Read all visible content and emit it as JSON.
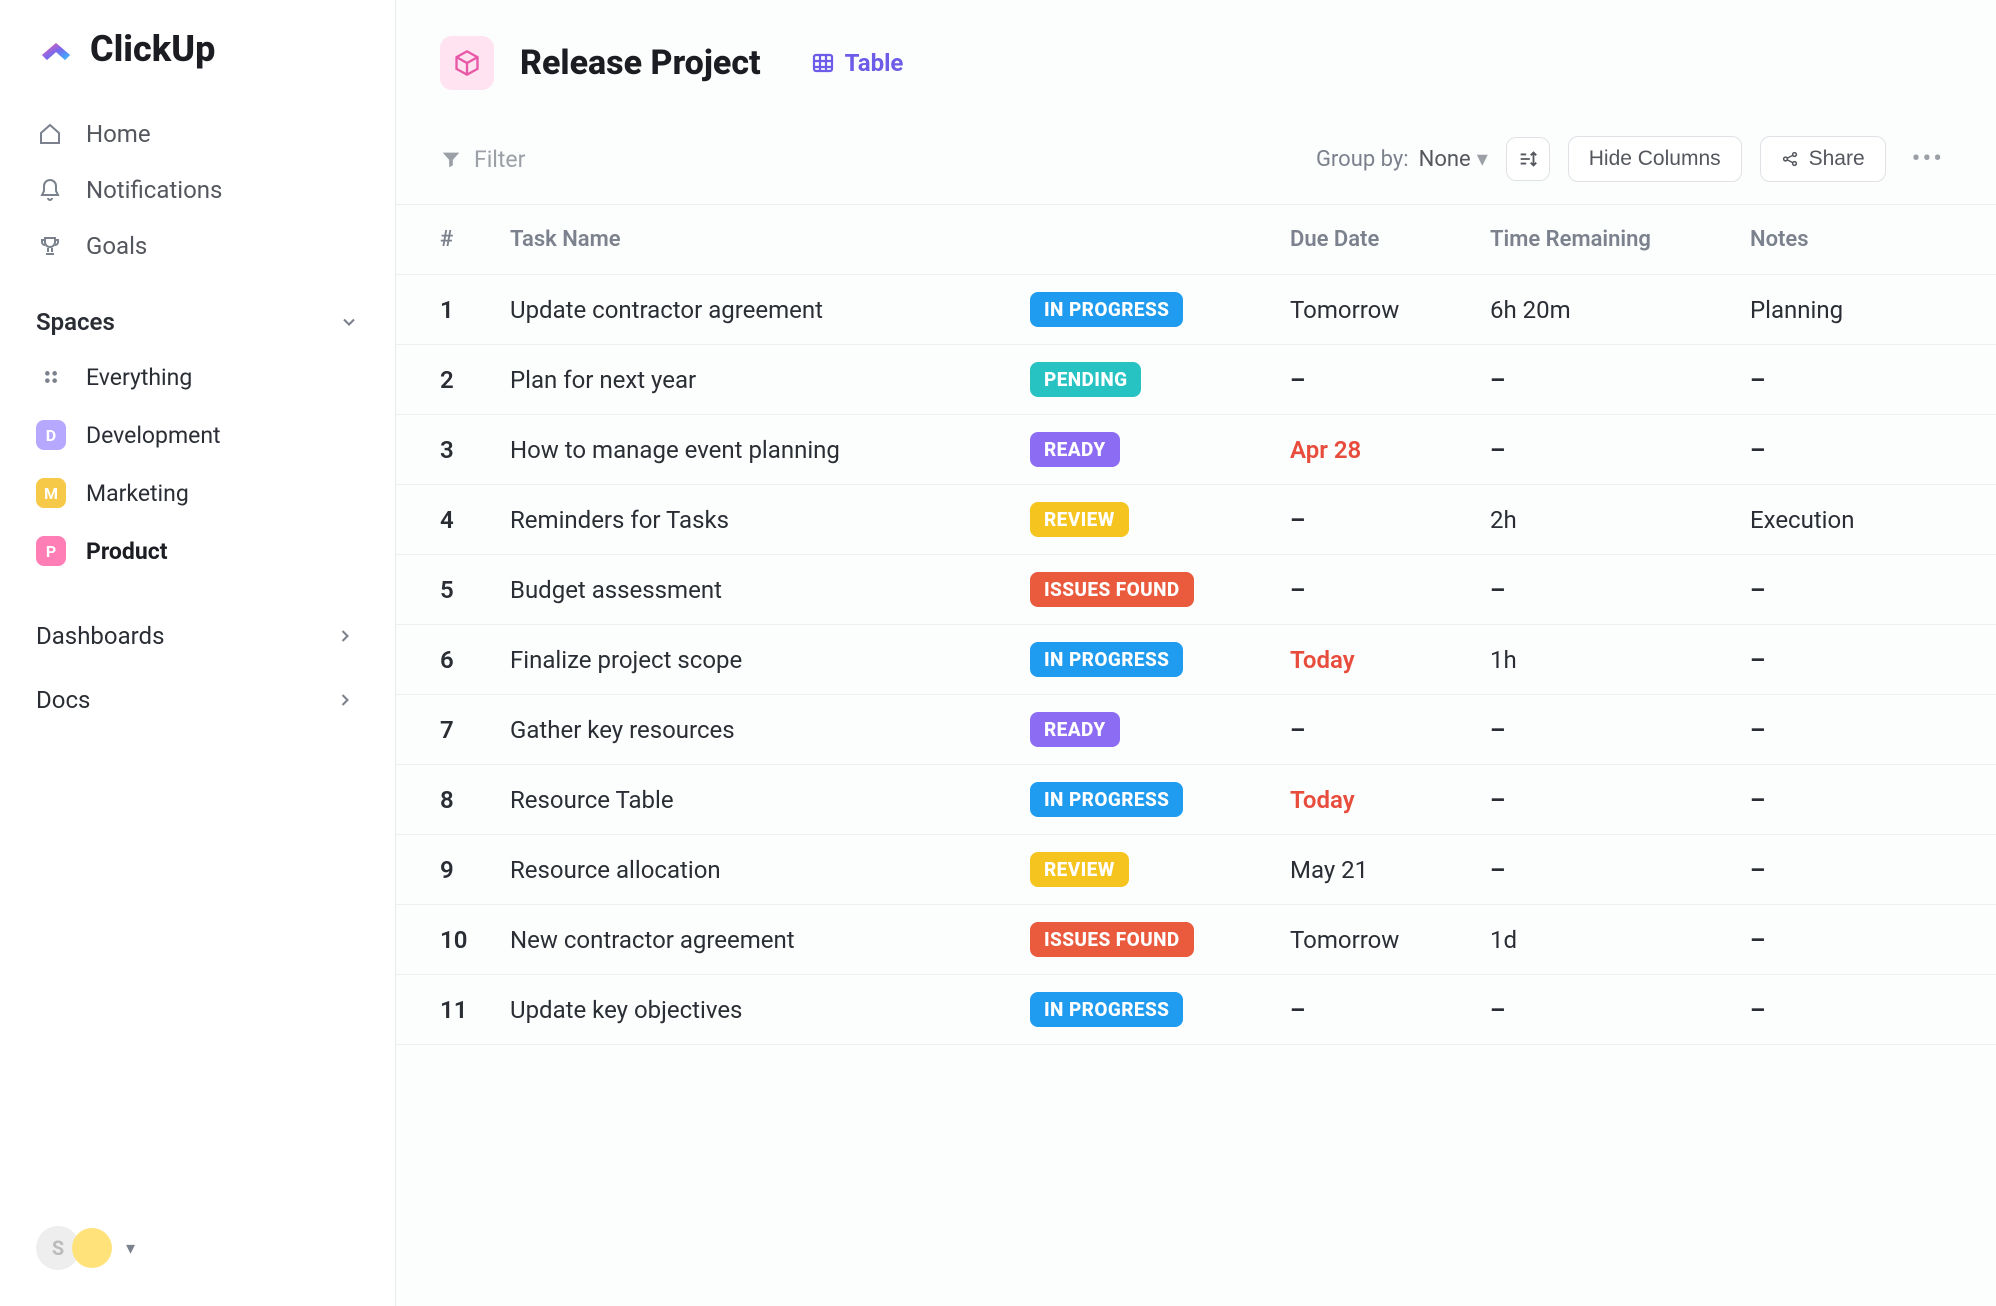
{
  "brand": {
    "name": "ClickUp"
  },
  "sidebar": {
    "nav": [
      {
        "label": "Home"
      },
      {
        "label": "Notifications"
      },
      {
        "label": "Goals"
      }
    ],
    "spaces": {
      "title": "Spaces",
      "everything_label": "Everything",
      "items": [
        {
          "letter": "D",
          "label": "Development",
          "color": "#b7a8ff"
        },
        {
          "letter": "M",
          "label": "Marketing",
          "color": "#f7c948"
        },
        {
          "letter": "P",
          "label": "Product",
          "color": "#ff7eb6",
          "active": true
        }
      ]
    },
    "sections": [
      {
        "label": "Dashboards"
      },
      {
        "label": "Docs"
      }
    ],
    "avatar_letter": "S"
  },
  "header": {
    "project_title": "Release Project",
    "view_label": "Table"
  },
  "toolbar": {
    "filter_label": "Filter",
    "groupby_label": "Group by:",
    "groupby_value": "None",
    "hide_columns_label": "Hide Columns",
    "share_label": "Share"
  },
  "columns": {
    "num": "#",
    "task": "Task Name",
    "status": "",
    "due": "Due Date",
    "time": "Time Remaining",
    "notes": "Notes"
  },
  "status_styles": {
    "IN PROGRESS": "st-inprogress",
    "PENDING": "st-pending",
    "READY": "st-ready",
    "REVIEW": "st-review",
    "ISSUES FOUND": "st-issues"
  },
  "urgent_due_values": [
    "Today",
    "Apr 28"
  ],
  "tasks": [
    {
      "n": "1",
      "name": "Update contractor agreement",
      "status": "IN PROGRESS",
      "due": "Tomorrow",
      "time": "6h 20m",
      "notes": "Planning"
    },
    {
      "n": "2",
      "name": "Plan for next year",
      "status": "PENDING",
      "due": "–",
      "time": "–",
      "notes": "–"
    },
    {
      "n": "3",
      "name": "How to manage event planning",
      "status": "READY",
      "due": "Apr 28",
      "time": "–",
      "notes": "–"
    },
    {
      "n": "4",
      "name": "Reminders for Tasks",
      "status": "REVIEW",
      "due": "–",
      "time": "2h",
      "notes": "Execution"
    },
    {
      "n": "5",
      "name": "Budget assessment",
      "status": "ISSUES FOUND",
      "due": "–",
      "time": "–",
      "notes": "–"
    },
    {
      "n": "6",
      "name": "Finalize project  scope",
      "status": "IN PROGRESS",
      "due": "Today",
      "time": "1h",
      "notes": "–"
    },
    {
      "n": "7",
      "name": "Gather key resources",
      "status": "READY",
      "due": "–",
      "time": "–",
      "notes": "–"
    },
    {
      "n": "8",
      "name": "Resource Table",
      "status": "IN PROGRESS",
      "due": "Today",
      "time": "–",
      "notes": "–"
    },
    {
      "n": "9",
      "name": "Resource allocation",
      "status": "REVIEW",
      "due": "May 21",
      "time": "–",
      "notes": "–"
    },
    {
      "n": "10",
      "name": "New contractor agreement",
      "status": "ISSUES FOUND",
      "due": "Tomorrow",
      "time": "1d",
      "notes": "–"
    },
    {
      "n": "11",
      "name": "Update key objectives",
      "status": "IN PROGRESS",
      "due": "–",
      "time": "–",
      "notes": "–"
    }
  ]
}
